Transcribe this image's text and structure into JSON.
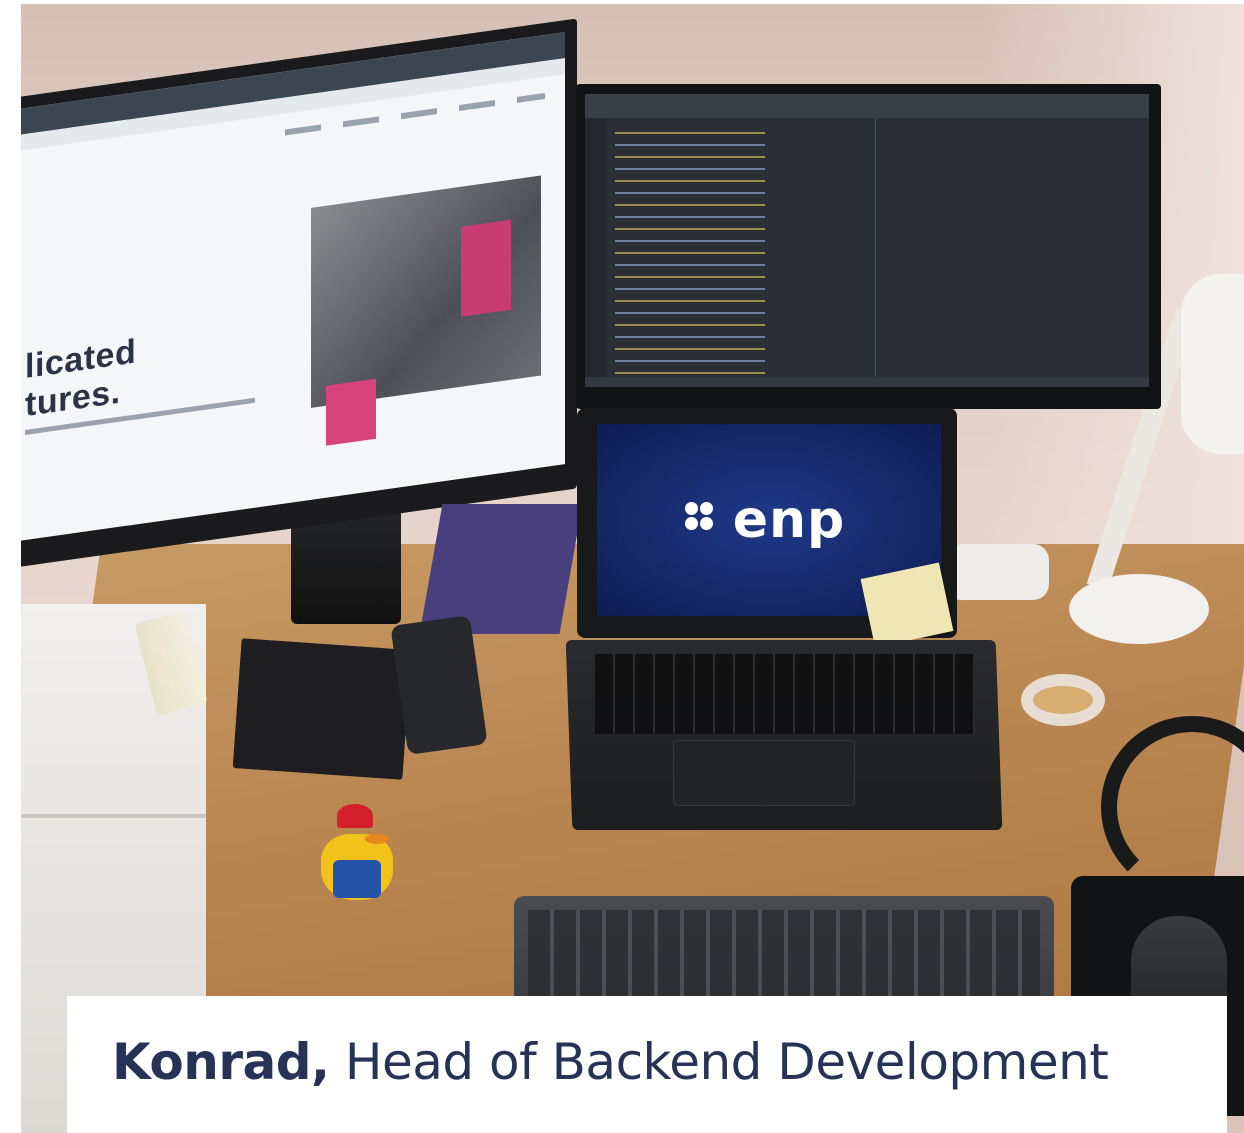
{
  "caption": {
    "name": "Konrad,",
    "role": "Head of Backend Development"
  },
  "photo": {
    "laptop_logo": "enp",
    "monitor_website_heading": [
      "licated",
      "tures."
    ]
  },
  "colors": {
    "caption_text": "#263356",
    "laptop_screen": "#16296b",
    "accent_pink": "#c83c6f"
  }
}
